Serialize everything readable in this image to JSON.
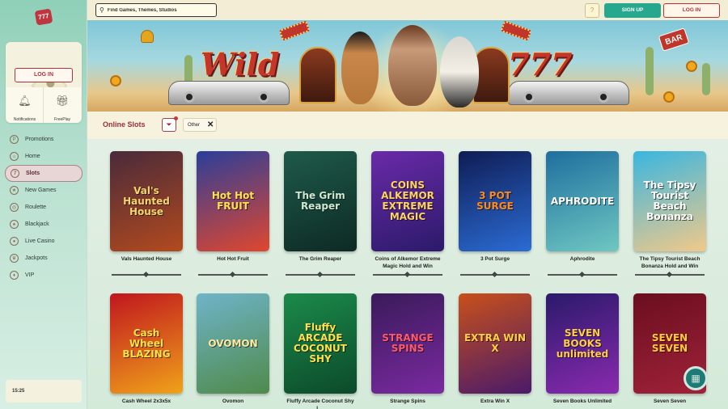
{
  "brand": {
    "logo_text": "777"
  },
  "account": {
    "login_label": "LOG IN",
    "notifications_label": "Notifications",
    "freeplay_label": "FreePlay"
  },
  "nav": {
    "items": [
      {
        "label": "Promotions",
        "icon": "P"
      },
      {
        "label": "Home",
        "icon": "⌂"
      },
      {
        "label": "Slots",
        "icon": "7"
      },
      {
        "label": "New Games",
        "icon": "★"
      },
      {
        "label": "Roulette",
        "icon": "◎"
      },
      {
        "label": "Blackjack",
        "icon": "♠"
      },
      {
        "label": "Live Casino",
        "icon": "●"
      },
      {
        "label": "Jackpots",
        "icon": "♛"
      },
      {
        "label": "VIP",
        "icon": "♦"
      }
    ],
    "active": "Slots"
  },
  "clock": "15:25",
  "topbar": {
    "search_placeholder": "Find Games, Themes, Studios",
    "help_label": "?",
    "signup_label": "SIGN UP",
    "login_label": "LOG IN"
  },
  "banner": {
    "word_left": "Wild",
    "word_right": "777",
    "sign": "BAR"
  },
  "filters": {
    "section_title": "Online Slots",
    "chip_label": "Other",
    "chip_close": "✕"
  },
  "games": [
    {
      "name": "Vals Haunted House",
      "art": "Val's Haunted House",
      "bg": "#4a2a3a",
      "bg2": "#b24a1e",
      "fg": "#f3d56b"
    },
    {
      "name": "Hot Hot Fruit",
      "art": "Hot Hot FRUIT",
      "bg": "#2b3e9a",
      "bg2": "#e0472e",
      "fg": "#ffe14a"
    },
    {
      "name": "The Grim Reaper",
      "art": "The Grim Reaper",
      "bg": "#1e5a4a",
      "bg2": "#0d2a24",
      "fg": "#cfe8d2"
    },
    {
      "name": "Coins of Alkemor Extreme Magic Hold and Win",
      "art": "COINS ALKEMOR EXTREME MAGIC",
      "bg": "#6a2aa8",
      "bg2": "#2b1a6a",
      "fg": "#ffd45c"
    },
    {
      "name": "3 Pot Surge",
      "art": "3 POT SURGE",
      "bg": "#0f1c54",
      "bg2": "#2b6cd4",
      "fg": "#ff8a1e"
    },
    {
      "name": "Aphrodite",
      "art": "APHRODITE",
      "bg": "#1e6f9e",
      "bg2": "#6fc7c2",
      "fg": "#ffffff"
    },
    {
      "name": "The Tipsy Tourist Beach Bonanza Hold and Win",
      "art": "The Tipsy Tourist Beach Bonanza",
      "bg": "#39b6e0",
      "bg2": "#f1c98a",
      "fg": "#ffffff"
    },
    {
      "name": "Cash Wheel 2x3x5x",
      "art": "Cash Wheel BLAZING",
      "bg": "#c0161e",
      "bg2": "#f0a21a",
      "fg": "#ffe14a"
    },
    {
      "name": "Ovomon",
      "art": "OVOMON",
      "bg": "#6fb4c9",
      "bg2": "#4f8a4a",
      "fg": "#ffe9a0"
    },
    {
      "name": "Fluffy Arcade Coconut Shy L...",
      "art": "Fluffy ARCADE COCONUT SHY",
      "bg": "#1b8a4a",
      "bg2": "#0c4a2a",
      "fg": "#ffe04a"
    },
    {
      "name": "Strange Spins",
      "art": "STRANGE SPINS",
      "bg": "#3a1a5a",
      "bg2": "#7a2aa0",
      "fg": "#ff5a6a"
    },
    {
      "name": "Extra Win X",
      "art": "EXTRA WIN X",
      "bg": "#c8501a",
      "bg2": "#4a1a6a",
      "fg": "#ffd040"
    },
    {
      "name": "Seven Books Unlimited",
      "art": "SEVEN BOOKS unlimited",
      "bg": "#2a1a6a",
      "bg2": "#8a2ab0",
      "fg": "#ffcf40"
    },
    {
      "name": "Seven Seven",
      "art": "SEVEN SEVEN",
      "bg": "#6a0e1e",
      "bg2": "#a0223a",
      "fg": "#ffcc33"
    }
  ],
  "chat": {
    "icon": "chat-icon"
  }
}
